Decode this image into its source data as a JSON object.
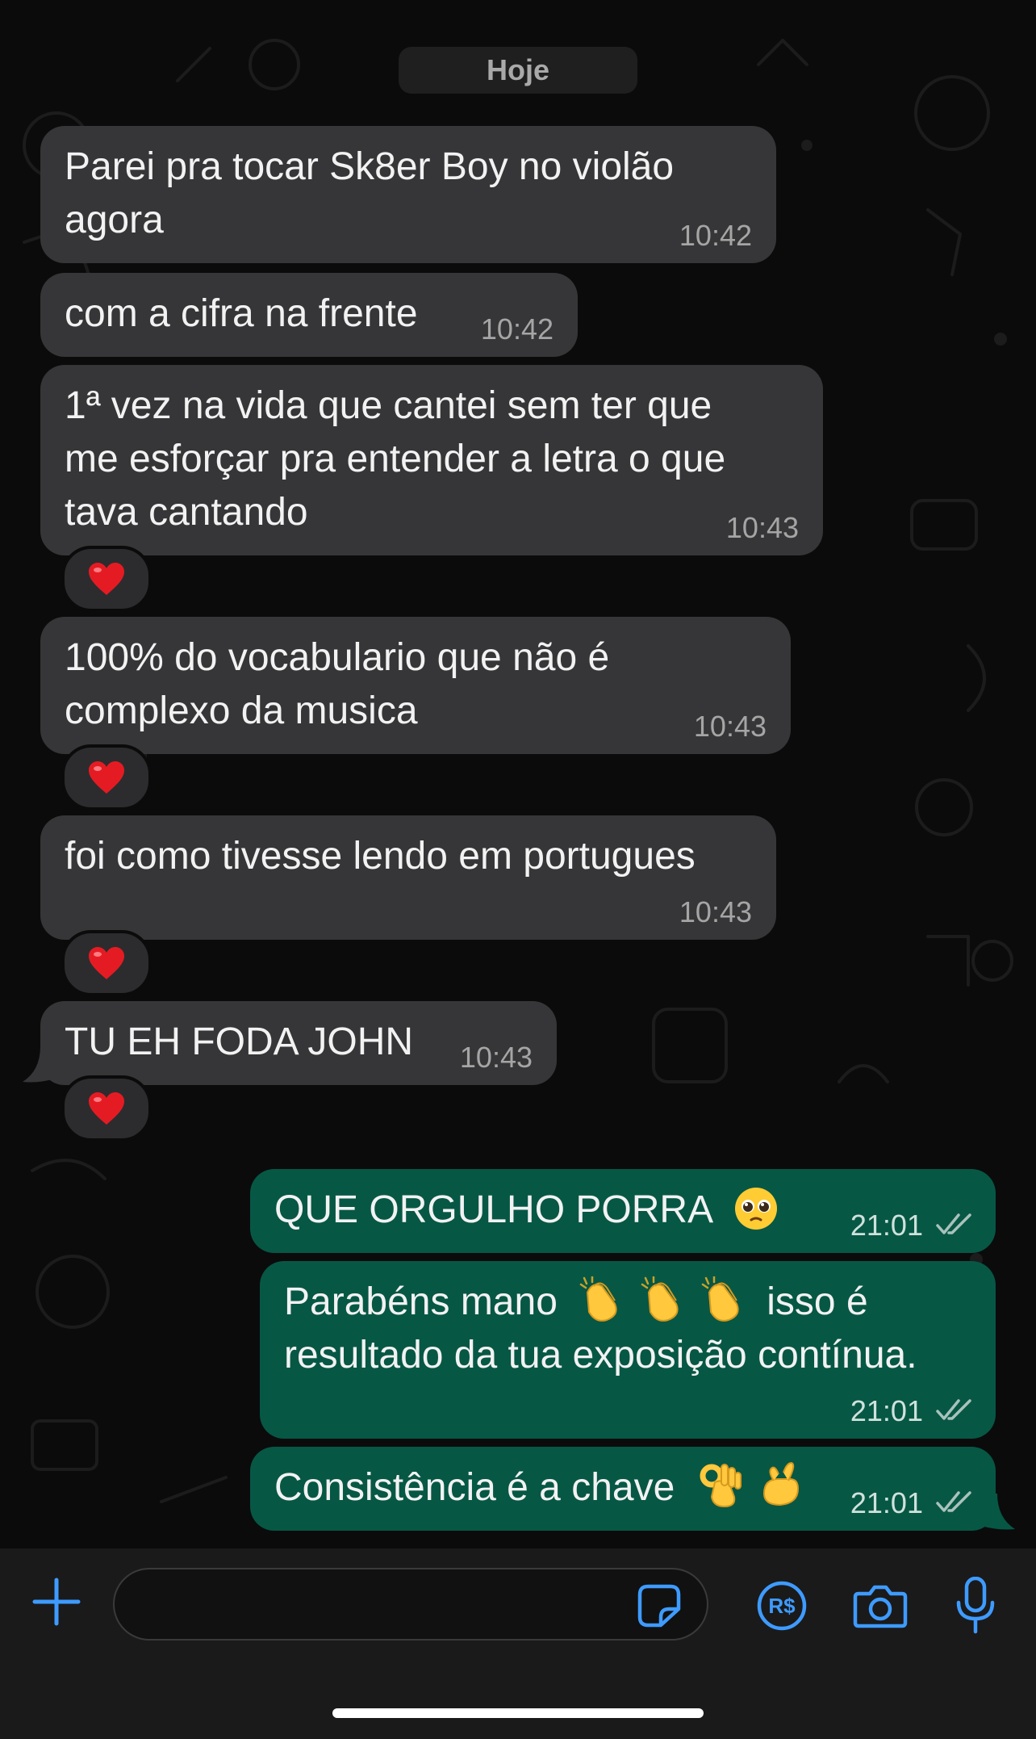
{
  "date_separator": "Hoje",
  "messages": [
    {
      "direction": "in",
      "text": "Parei pra tocar Sk8er Boy no violão agora",
      "time": "10:42"
    },
    {
      "direction": "in",
      "text": "com a cifra na frente",
      "time": "10:42"
    },
    {
      "direction": "in",
      "text": "1ª vez na vida que cantei sem ter que me esforçar pra entender a letra o que tava cantando",
      "time": "10:43",
      "reaction": "red-heart"
    },
    {
      "direction": "in",
      "text": "100% do vocabulario que não é complexo da musica",
      "time": "10:43",
      "reaction": "red-heart"
    },
    {
      "direction": "in",
      "text": "foi como tivesse lendo em portugues",
      "time": "10:43",
      "reaction": "red-heart"
    },
    {
      "direction": "in",
      "text": "TU EH FODA JOHN",
      "time": "10:43",
      "reaction": "red-heart"
    },
    {
      "direction": "out",
      "text": "QUE ORGULHO PORRA",
      "emoji": [
        "pleading-face"
      ],
      "time": "21:01",
      "status": "read"
    },
    {
      "direction": "out",
      "text_before": "Parabéns mano",
      "emoji": [
        "clapping-hands",
        "clapping-hands",
        "clapping-hands"
      ],
      "text_after": "isso é",
      "text_line2": "resultado da tua exposição contínua.",
      "time": "21:01",
      "status": "read"
    },
    {
      "direction": "out",
      "text": "Consistência é a chave",
      "emoji": [
        "ok-hand",
        "pinching-hand"
      ],
      "time": "21:01",
      "status": "read"
    }
  ],
  "composer": {
    "icons": [
      "plus-icon",
      "sticker-icon",
      "payment-icon",
      "camera-icon",
      "microphone-icon"
    ],
    "payment_label": "R$"
  },
  "colors": {
    "incoming_bubble": "#363638",
    "outgoing_bubble": "#075745",
    "accent": "#3e9bff",
    "background": "#0b0b0b"
  }
}
